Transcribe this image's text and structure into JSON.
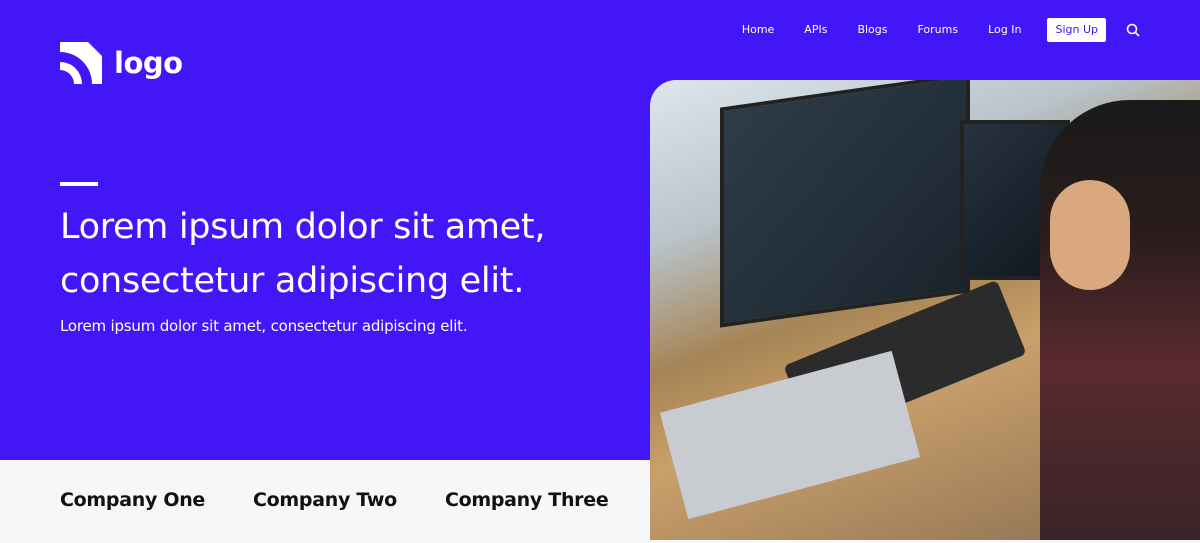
{
  "brand": {
    "logo_text": "logo",
    "accent": "#4216f7"
  },
  "nav": {
    "items": [
      "Home",
      "APIs",
      "Blogs",
      "Forums",
      "Log In"
    ],
    "signup": "Sign Up",
    "search_icon": "search-icon"
  },
  "hero": {
    "title": "Lorem ipsum dolor sit amet, consectetur adipiscing elit.",
    "subtitle": "Lorem ipsum dolor sit amet, consectetur adipiscing elit."
  },
  "companies": [
    "Company One",
    "Company Two",
    "Company Three"
  ]
}
